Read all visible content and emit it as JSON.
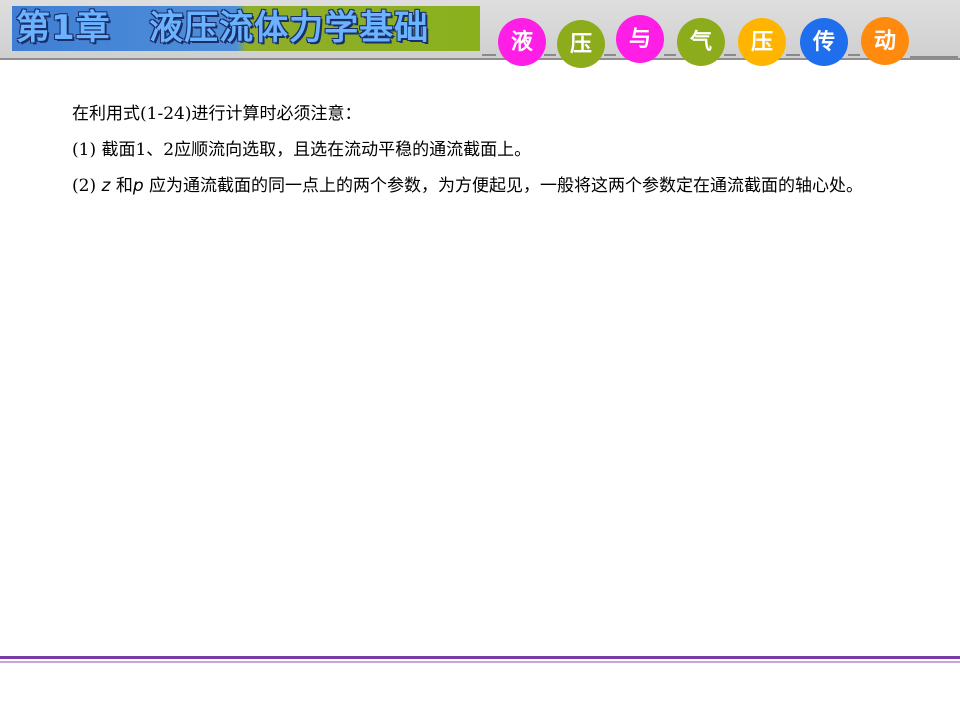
{
  "header": {
    "chapter_title": "第1章   液压流体力学基础",
    "circles": [
      {
        "char": "液",
        "color": "#ff1ee6"
      },
      {
        "char": "压",
        "color": "#8dac1c"
      },
      {
        "char": "与",
        "color": "#ff1ee6"
      },
      {
        "char": "气",
        "color": "#8dac1c"
      },
      {
        "char": "压",
        "color": "#ffb400"
      },
      {
        "char": "传",
        "color": "#1e6eee"
      },
      {
        "char": "动",
        "color": "#ff8a0e"
      }
    ]
  },
  "content": {
    "p1": "在利用式(1-24)进行计算时必须注意：",
    "p2": "(1) 截面1、2应顺流向选取，且选在流动平稳的通流截面上。",
    "p3_prefix": "(2) ",
    "p3_var_z": "z",
    "p3_mid": " 和",
    "p3_var_p": "p",
    "p3_suffix": " 应为通流截面的同一点上的两个参数，为方便起见，一般将这两个参数定在通流截面的轴心处。"
  }
}
